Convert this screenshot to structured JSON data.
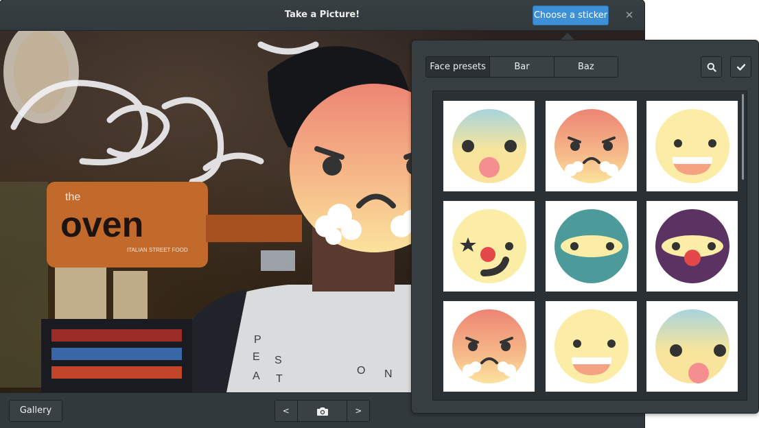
{
  "window": {
    "title": "Take a Picture!",
    "choose_sticker_label": "Choose a sticker",
    "close_label": "✕"
  },
  "bottom_bar": {
    "gallery_label": "Gallery",
    "prev_label": "<",
    "next_label": ">"
  },
  "popover": {
    "tabs": [
      {
        "label": "Face presets"
      },
      {
        "label": "Bar"
      },
      {
        "label": "Baz"
      }
    ],
    "stickers": [
      "shocked-face-icon",
      "angry-face-icon",
      "grinning-face-icon",
      "clown-face-icon",
      "ninja-teal-face-icon",
      "ninja-purple-face-icon",
      "angry-face-icon",
      "grinning-face-icon",
      "shocked-face-icon"
    ]
  },
  "preview": {
    "sign_text": "the oven",
    "sign_subtitle": "ITALIAN STREET FOOD"
  },
  "colors": {
    "accent": "#3d8fd6",
    "window_bg": "#2d3236",
    "popover_bg": "#373e42"
  }
}
